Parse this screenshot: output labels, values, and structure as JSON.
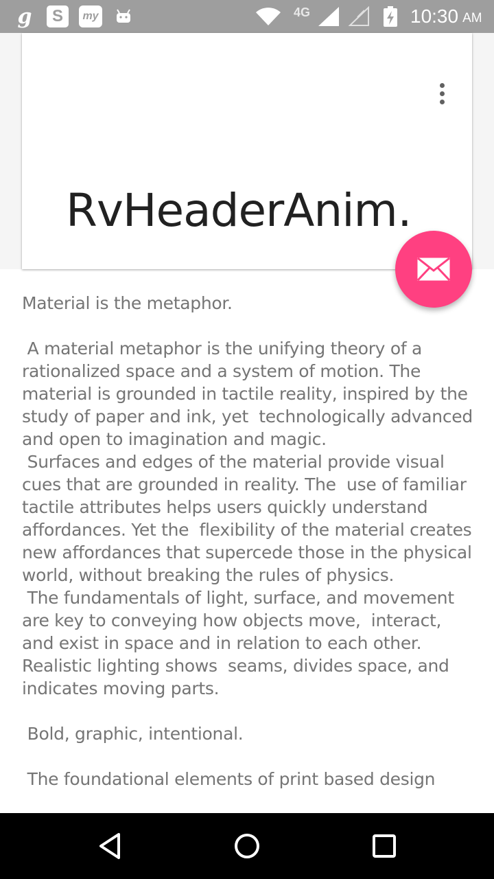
{
  "status_bar": {
    "carrier_icon_g": "g",
    "app_icon_s": "S",
    "app_icon_my": "my",
    "network_type": "4G",
    "time": "10:30",
    "am_pm": "AM",
    "icons": [
      "g-icon",
      "s-app-icon",
      "my-app-icon",
      "android-icon",
      "wifi-icon",
      "signal-icon",
      "signal-empty-icon",
      "battery-charging-icon"
    ]
  },
  "header": {
    "title": "RvHeaderAnim…",
    "overflow_icon": "more-vert-icon",
    "background_color": "#f5f5f5"
  },
  "fab": {
    "icon": "mail-icon",
    "color": "#ff4081"
  },
  "content": {
    "text": "Material is the metaphor.\n\n A material metaphor is the unifying theory of a rationalized space and a system of motion. The material is grounded in tactile reality, inspired by the study of paper and ink, yet  technologically advanced and open to imagination and magic.\n Surfaces and edges of the material provide visual cues that are grounded in reality. The  use of familiar tactile attributes helps users quickly understand affordances. Yet the  flexibility of the material creates new affordances that supercede those in the physical  world, without breaking the rules of physics.\n The fundamentals of light, surface, and movement are key to conveying how objects move,  interact, and exist in space and in relation to each other. Realistic lighting shows  seams, divides space, and indicates moving parts.\n\n Bold, graphic, intentional.\n\n The foundational elements of print based design"
  },
  "nav_bar": {
    "icons": [
      "back-icon",
      "home-icon",
      "recents-icon"
    ]
  }
}
